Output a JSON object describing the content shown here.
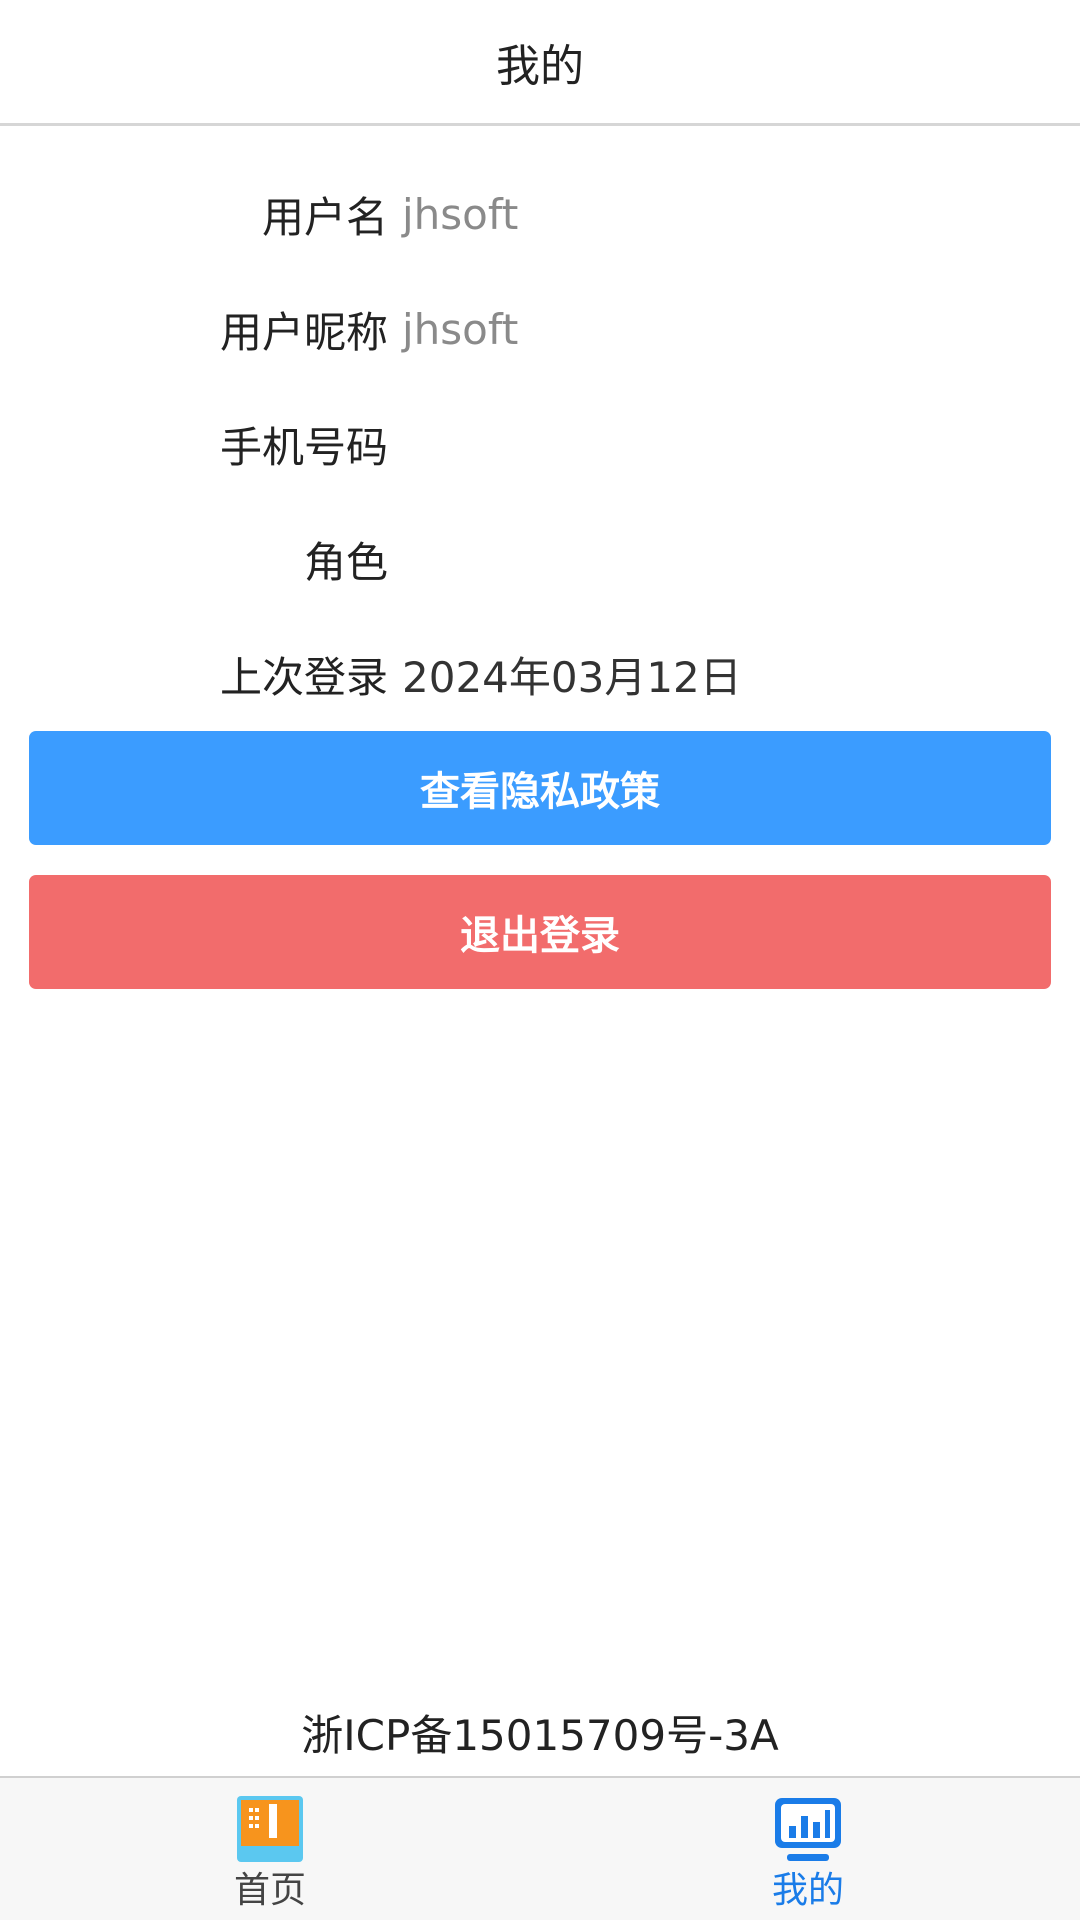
{
  "header": {
    "title": "我的"
  },
  "profile": {
    "rows": [
      {
        "label": "用户名",
        "value": "jhsoft"
      },
      {
        "label": "用户昵称",
        "value": "jhsoft"
      },
      {
        "label": "手机号码",
        "value": ""
      },
      {
        "label": "角色",
        "value": ""
      },
      {
        "label": "上次登录",
        "value": "2024年03月12日"
      }
    ]
  },
  "actions": {
    "privacy_label": "查看隐私政策",
    "logout_label": "退出登录",
    "privacy_color": "#3b9cff",
    "logout_color": "#f26c6c"
  },
  "footer": {
    "icp": "浙ICP备15015709号-3A"
  },
  "tabbar": {
    "items": [
      {
        "label": "首页",
        "icon": "home-icon",
        "active": false
      },
      {
        "label": "我的",
        "icon": "chart-icon",
        "active": true
      }
    ],
    "active_color": "#1a7ce8"
  }
}
